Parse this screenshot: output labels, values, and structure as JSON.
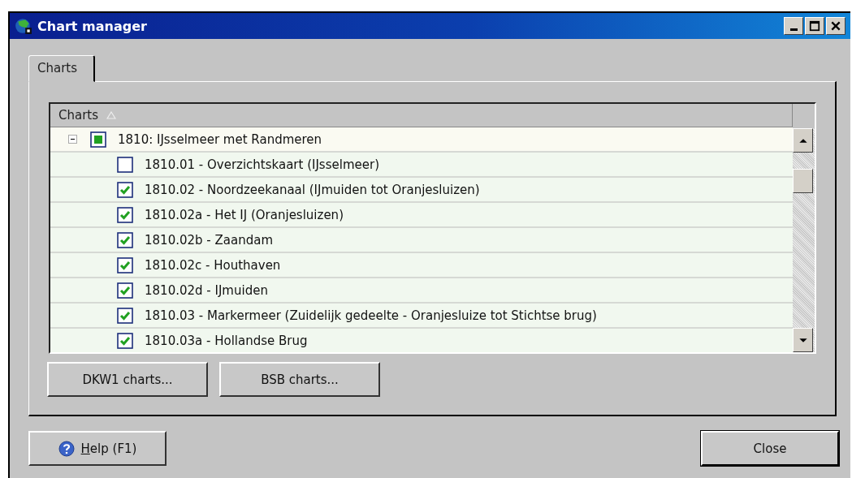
{
  "window": {
    "title": "Chart manager"
  },
  "tabs": [
    {
      "label": "Charts",
      "selected": true
    }
  ],
  "list": {
    "column": "Charts",
    "sort_ascending": true,
    "items": [
      {
        "label": "1810: IJsselmeer met Randmeren",
        "mixed": true,
        "expanded": true,
        "children": [
          {
            "label": "1810.01 - Overzichtskaart (IJsselmeer)",
            "checked": false
          },
          {
            "label": "1810.02 - Noordzeekanaal (IJmuiden tot Oranjesluizen)",
            "checked": true
          },
          {
            "label": "1810.02a - Het IJ (Oranjesluizen)",
            "checked": true
          },
          {
            "label": "1810.02b - Zaandam",
            "checked": true
          },
          {
            "label": "1810.02c - Houthaven",
            "checked": true
          },
          {
            "label": "1810.02d - IJmuiden",
            "checked": true
          },
          {
            "label": "1810.03 - Markermeer (Zuidelijk gedeelte - Oranjesluize tot Stichtse brug)",
            "checked": true
          },
          {
            "label": "1810.03a - Hollandse Brug",
            "checked": true
          }
        ]
      }
    ]
  },
  "panel_buttons": [
    "DKW1 charts...",
    "BSB charts..."
  ],
  "footer": {
    "help": "Help (F1)",
    "close": "Close"
  }
}
